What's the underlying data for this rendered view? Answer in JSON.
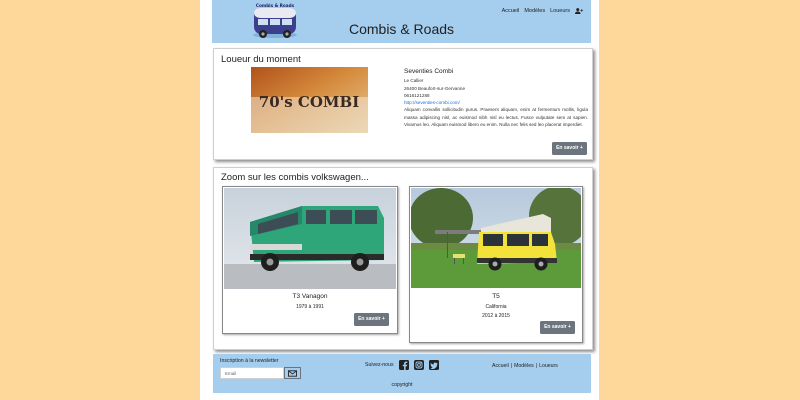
{
  "header": {
    "site_title": "Combis & Roads",
    "logo_text": "Combis & Roads",
    "nav": [
      "Accueil",
      "Modèles",
      "Loueurs"
    ]
  },
  "featured": {
    "heading": "Loueur du moment",
    "image_text": "70's COMBI",
    "name": "Seventies Combi",
    "address_line1": "Le Callier",
    "address_line2": "26400 Beaufort-sur-Gervanne",
    "phone": "0616121288",
    "website": "http://seventies-combi.com/",
    "description": "Aliquam convallis sollicitudin purus. Praesent aliquam, enim at fermentum mollis, ligula massa adipiscing nisl, ac euismod nibh nisl eu lectus. Fusce vulputate sem at sapien. Vivamus leo. Aliquam euismod libero eu enim. Nulla nec felis sed leo placerat imperdiet.",
    "button_label": "En savoir +"
  },
  "zoom": {
    "heading": "Zoom sur les combis volkswagen...",
    "models": [
      {
        "name": "T3 Vanagon",
        "subtitle": "",
        "years": "1979 à 1991",
        "button_label": "En savoir +"
      },
      {
        "name": "T5",
        "subtitle": "California",
        "years": "2012 à 2015",
        "button_label": "En savoir +"
      }
    ]
  },
  "footer": {
    "newsletter_label": "Inscription à la newsletter",
    "email_placeholder": "Email",
    "follow_label": "Suivez-nous",
    "links": [
      "Accueil",
      "Modèles",
      "Loueurs"
    ],
    "separator": "|",
    "copyright": "copyright"
  },
  "colors": {
    "background": "#fdd89a",
    "header_footer": "#a4cdee",
    "button": "#6c757d",
    "van_green": "#2fa57a",
    "van_yellow": "#f2e23a",
    "link": "#1e6fd9"
  }
}
